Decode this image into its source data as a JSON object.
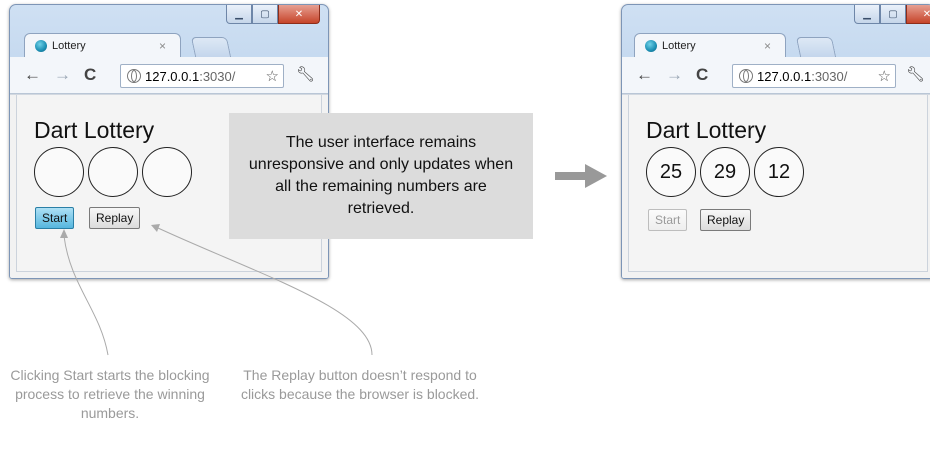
{
  "before_window": {
    "tab_title": "Lottery",
    "tab_close": "×",
    "url_host": "127.0.0.1",
    "url_path": ":3030/",
    "app_title": "Dart Lottery",
    "balls": [
      "",
      "",
      ""
    ],
    "start_label": "Start",
    "replay_label": "Replay"
  },
  "after_window": {
    "tab_title": "Lottery",
    "tab_close": "×",
    "url_host": "127.0.0.1",
    "url_path": ":3030/",
    "app_title": "Dart Lottery",
    "balls": [
      "25",
      "29",
      "12"
    ],
    "start_label": "Start",
    "replay_label": "Replay"
  },
  "callout_text": "The user interface remains unresponsive and only updates when all the remaining numbers are retrieved.",
  "caption_start": "Clicking Start starts the blocking process to retrieve the winning numbers.",
  "caption_replay": "The Replay button doesn’t respond to clicks because the browser is blocked.",
  "icons": [
    "back-icon",
    "forward-icon",
    "reload-icon",
    "globe-icon",
    "star-icon",
    "wrench-icon",
    "favicon-icon",
    "arrow-right-icon"
  ],
  "colors": {
    "active_button": "#56b6de",
    "callout_bg": "#dcdcdc",
    "caption_text": "#9a9a9a",
    "arrow": "#999999"
  }
}
